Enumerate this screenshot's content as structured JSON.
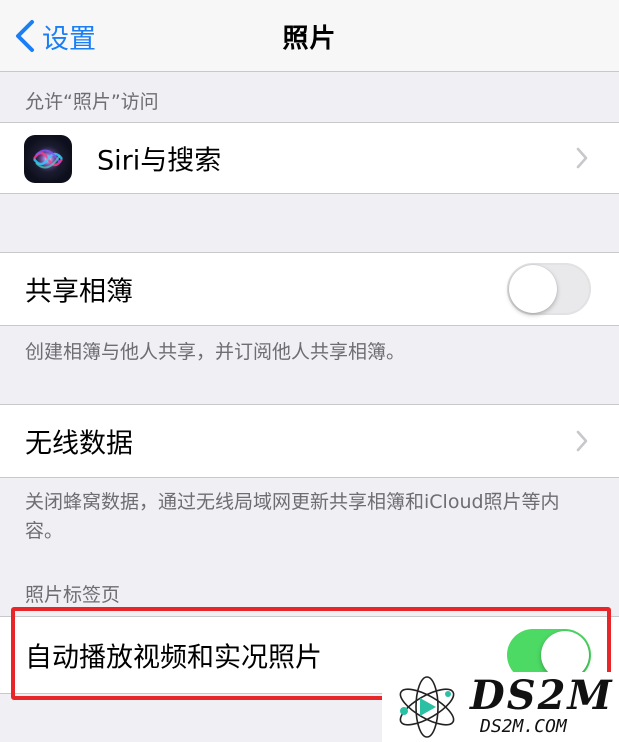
{
  "nav": {
    "back_label": "设置",
    "title": "照片"
  },
  "sections": {
    "access_header": "允许“照片”访问",
    "siri_label": "Siri与搜索",
    "shared_album_label": "共享相簿",
    "shared_album_toggle": "off",
    "shared_album_footer": "创建相簿与他人共享，并订阅他人共享相簿。",
    "wireless_data_label": "无线数据",
    "wireless_data_footer": "关闭蜂窝数据，通过无线局域网更新共享相簿和iCloud照片等内容。",
    "photos_tab_header": "照片标签页",
    "autoplay_label": "自动播放视频和实况照片",
    "autoplay_toggle": "on"
  },
  "watermark": {
    "text": "DS2M",
    "sub": "DS2M.COM"
  },
  "colors": {
    "accent": "#1b7ef5",
    "toggle_on": "#4cd964",
    "highlight": "#e8262a"
  },
  "icons": {
    "back": "chevron-left-icon",
    "siri": "siri-icon",
    "disclosure": "chevron-right-icon"
  }
}
